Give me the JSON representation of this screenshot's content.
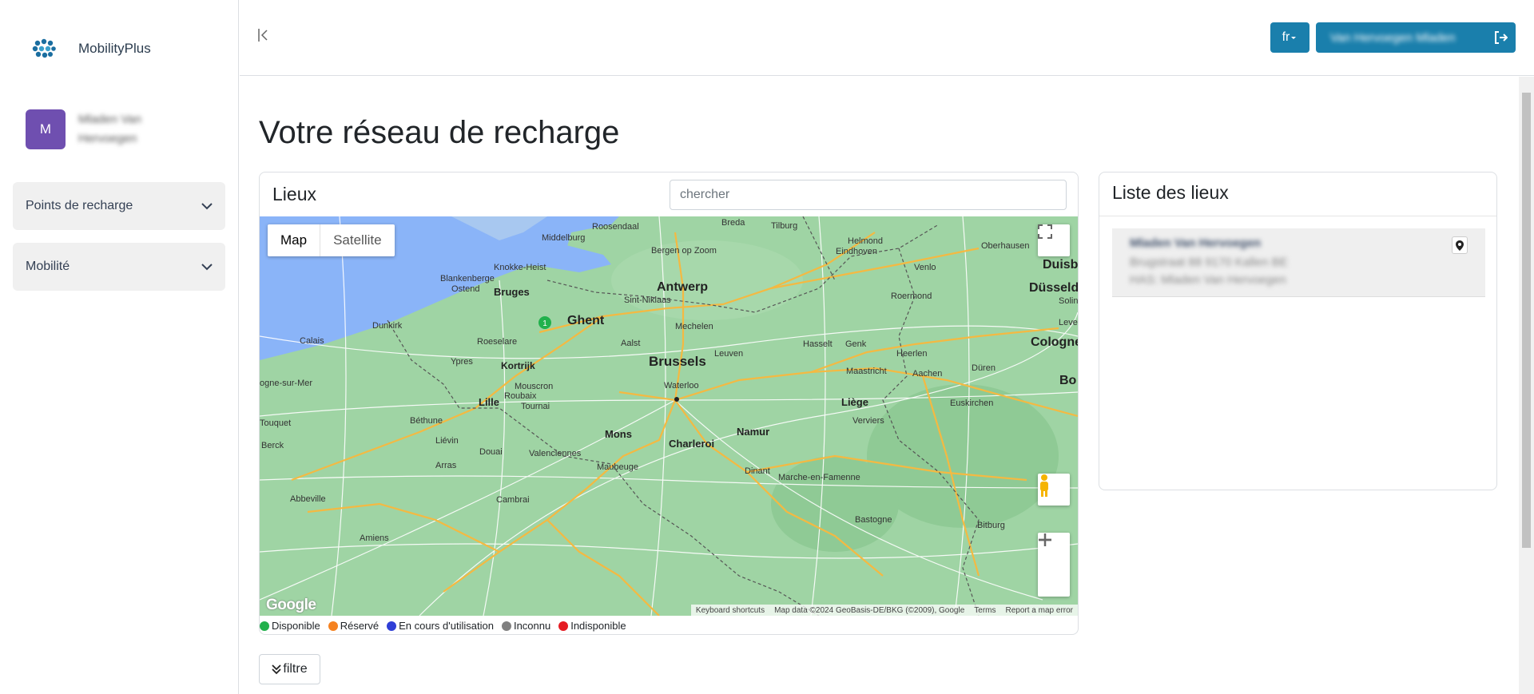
{
  "app": {
    "name": "MobilityPlus"
  },
  "user": {
    "initial": "M",
    "name": "Mladen Van Hervoegen"
  },
  "sidebar": {
    "items": [
      {
        "label": "Points de recharge"
      },
      {
        "label": "Mobilité"
      }
    ]
  },
  "header": {
    "lang": "fr",
    "user_button": "Van Hervoegen Mladen"
  },
  "page": {
    "title": "Votre réseau de recharge"
  },
  "map_card": {
    "title": "Lieux",
    "search_placeholder": "chercher",
    "map_type": {
      "map": "Map",
      "satellite": "Satellite"
    },
    "cluster_count": "1",
    "attribution": {
      "shortcuts": "Keyboard shortcuts",
      "data": "Map data ©2024 GeoBasis-DE/BKG (©2009), Google",
      "terms": "Terms",
      "report": "Report a map error"
    },
    "google_logo": "Google",
    "cities": {
      "roosendaal": "Roosendaal",
      "breda": "Breda",
      "tilburg": "Tilburg",
      "helmond": "Helmond",
      "middelburg": "Middelburg",
      "bergen": "Bergen op Zoom",
      "eindhoven": "Eindhoven",
      "oberhausen": "Oberhausen",
      "knokke": "Knokke-Heist",
      "venlo": "Venlo",
      "duisburg": "Duisburg",
      "blankenberge": "Blankenberge",
      "ostend": "Ostend",
      "bruges": "Bruges",
      "antwerp": "Antwerp",
      "sintniklaas": "Sint-Niklaas",
      "roermond": "Roermond",
      "dusseldorf": "Düsseldorf",
      "solingen": "Soling",
      "dunkirk": "Dunkirk",
      "ghent": "Ghent",
      "mechelen": "Mechelen",
      "leverkusen": "Leverkus",
      "calais": "Calais",
      "roeselare": "Roeselare",
      "aalst": "Aalst",
      "hasselt": "Hasselt",
      "genk": "Genk",
      "heerlen": "Heerlen",
      "cologne": "Cologne",
      "ypres": "Ypres",
      "kortrijk": "Kortrijk",
      "brussels": "Brussels",
      "leuven": "Leuven",
      "maastricht": "Maastricht",
      "aachen": "Aachen",
      "duren": "Düren",
      "boulogne": "ogne-sur-Mer",
      "mouscron": "Mouscron",
      "waterloo": "Waterloo",
      "bonn": "Bo",
      "roubaix": "Roubaix",
      "lille": "Lille",
      "tournai": "Tournai",
      "liege": "Liège",
      "euskirchen": "Euskirchen",
      "bethune": "Béthune",
      "verviers": "Verviers",
      "letouquet": "Touquet",
      "namur": "Namur",
      "mons": "Mons",
      "charleroi": "Charleroi",
      "lievin": "Liévin",
      "berck": "Berck",
      "douai": "Douai",
      "valenciennes": "Valenciennes",
      "arras": "Arras",
      "maubeuge": "Maubeuge",
      "dinant": "Dinant",
      "marche": "Marche-en-Famenne",
      "abbeville": "Abbeville",
      "cambrai": "Cambrai",
      "bastogne": "Bastogne",
      "bitburg": "Bitburg",
      "amiens": "Amiens"
    }
  },
  "legend": [
    {
      "label": "Disponible",
      "color": "#22b14c"
    },
    {
      "label": "Réservé",
      "color": "#f58220"
    },
    {
      "label": "En cours d'utilisation",
      "color": "#2f3fd6"
    },
    {
      "label": "Inconnu",
      "color": "#808080"
    },
    {
      "label": "Indisponible",
      "color": "#e51c23"
    }
  ],
  "list_card": {
    "title": "Liste des lieux",
    "items": [
      {
        "name": "Mladen Van Hervoegen",
        "address": "Brugstraat 88 9170 Kallen BE",
        "detail": "HAS: Mladen Van Hervoegen"
      }
    ]
  },
  "filter_button": "filtre"
}
